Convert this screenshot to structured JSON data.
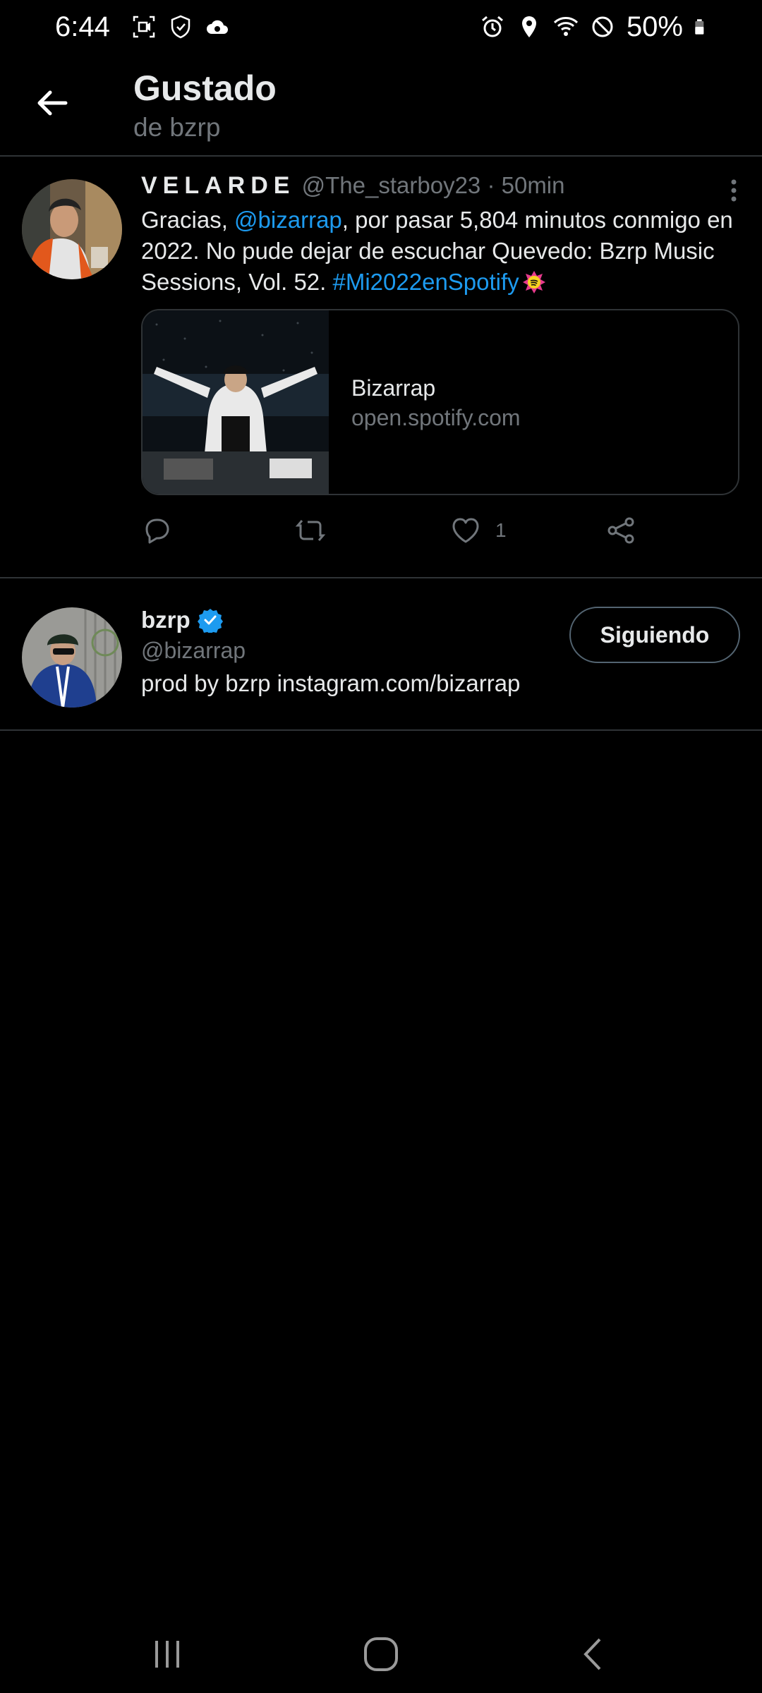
{
  "status_bar": {
    "time": "6:44",
    "battery_percent": "50%",
    "icons_left": [
      "screen-record-icon",
      "shield-icon",
      "cloud-sync-icon"
    ],
    "icons_right": [
      "alarm-icon",
      "location-icon",
      "wifi-icon",
      "do-not-disturb-icon",
      "battery-icon"
    ]
  },
  "header": {
    "title": "Gustado",
    "subtitle": "de bzrp"
  },
  "tweet": {
    "display_name": "VELARDE",
    "handle": "@The_starboy23",
    "time": "· 50min",
    "text_1": "Gracias, ",
    "mention": "@bizarrap",
    "text_2": ", por pasar 5,804 minutos conmigo en 2022. No pude dejar de escuchar Quevedo: Bzrp Music Sessions, Vol. 52. ",
    "hashtag": "#Mi2022enSpotify",
    "card": {
      "title": "Bizarrap",
      "domain": "open.spotify.com"
    },
    "like_count": "1"
  },
  "user": {
    "name": "bzrp",
    "handle": "@bizarrap",
    "bio": "prod by bzrp instagram.com/bizarrap",
    "follow_label": "Siguiendo"
  },
  "colors": {
    "background": "#000000",
    "accent": "#1d9bf0",
    "secondary_text": "#71767b",
    "divider": "#2f3336"
  }
}
